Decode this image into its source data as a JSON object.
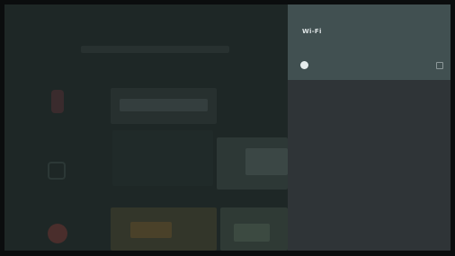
{
  "panel": {
    "title": "Wi-Fi",
    "network": {
      "name": "",
      "status": ""
    }
  },
  "colors": {
    "panel_header": "#415051",
    "panel_body": "#2f3437",
    "background": "#1e2726"
  },
  "icons": {
    "network_icon": "wifi-icon",
    "security_icon": "lock-icon"
  }
}
